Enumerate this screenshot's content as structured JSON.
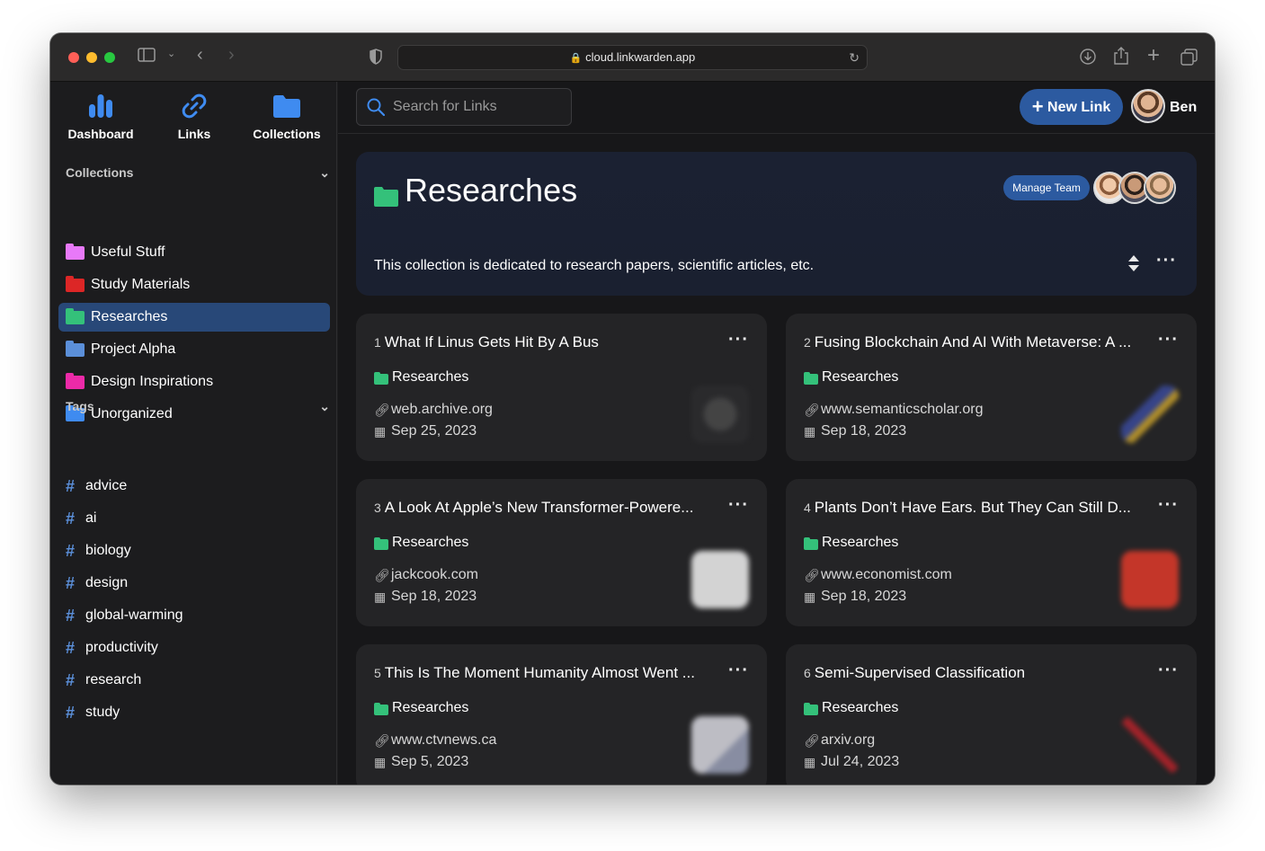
{
  "browser": {
    "url": "cloud.linkwarden.app"
  },
  "topnav": [
    {
      "label": "Dashboard",
      "icon": "bar-chart-icon"
    },
    {
      "label": "Links",
      "icon": "link-icon"
    },
    {
      "label": "Collections",
      "icon": "folder-icon"
    }
  ],
  "sidebar": {
    "collections_heading": "Collections",
    "collections": [
      {
        "label": "Useful Stuff",
        "color": "#e879f9"
      },
      {
        "label": "Study Materials",
        "color": "#dc2626"
      },
      {
        "label": "Researches",
        "color": "#34c17a",
        "active": true
      },
      {
        "label": "Project Alpha",
        "color": "#5b8fd9"
      },
      {
        "label": "Design Inspirations",
        "color": "#ec2aa8"
      },
      {
        "label": "Unorganized",
        "color": "#3f8bf0"
      }
    ],
    "tags_heading": "Tags",
    "tags": [
      "advice",
      "ai",
      "biology",
      "design",
      "global-warming",
      "productivity",
      "research",
      "study"
    ]
  },
  "topbar": {
    "search_placeholder": "Search for Links",
    "new_link_label": "New Link",
    "user_name": "Ben"
  },
  "collection": {
    "title": "Researches",
    "manage_team_label": "Manage Team",
    "description": "This collection is dedicated to research papers, scientific articles, etc.",
    "color": "#34c17a"
  },
  "links": [
    {
      "num": "1",
      "title": "What If Linus Gets Hit By A Bus",
      "collection": "Researches",
      "url": "web.archive.org",
      "date": "Sep 25, 2023"
    },
    {
      "num": "2",
      "title": "Fusing Blockchain And AI With Metaverse: A ...",
      "collection": "Researches",
      "url": "www.semanticscholar.org",
      "date": "Sep 18, 2023"
    },
    {
      "num": "3",
      "title": "A Look At Apple’s New Transformer-Powere...",
      "collection": "Researches",
      "url": "jackcook.com",
      "date": "Sep 18, 2023"
    },
    {
      "num": "4",
      "title": "Plants Don’t Have Ears. But They Can Still D...",
      "collection": "Researches",
      "url": "www.economist.com",
      "date": "Sep 18, 2023"
    },
    {
      "num": "5",
      "title": "This Is The Moment Humanity Almost Went ...",
      "collection": "Researches",
      "url": "www.ctvnews.ca",
      "date": "Sep 5, 2023"
    },
    {
      "num": "6",
      "title": "Semi-Supervised Classification",
      "collection": "Researches",
      "url": "arxiv.org",
      "date": "Jul 24, 2023"
    }
  ]
}
